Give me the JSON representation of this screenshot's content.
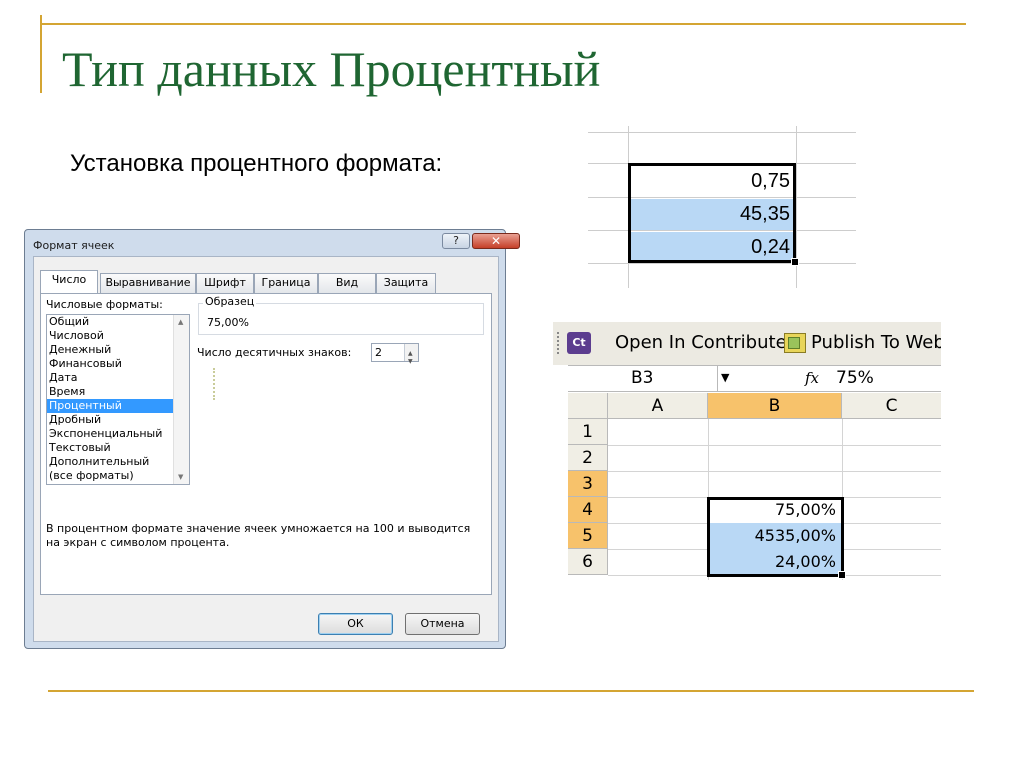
{
  "slide": {
    "title": "Тип данных Процентный",
    "subtitle": "Установка процентного формата:",
    "accent_color": "#d4a533",
    "title_color": "#1f6632"
  },
  "dialog": {
    "title": "Формат ячеек",
    "help": "?",
    "close": "✕",
    "tabs": [
      "Число",
      "Выравнивание",
      "Шрифт",
      "Граница",
      "Вид",
      "Защита"
    ],
    "active_tab": "Число",
    "category_label": "Числовые форматы:",
    "categories": [
      "Общий",
      "Числовой",
      "Денежный",
      "Финансовый",
      "Дата",
      "Время",
      "Процентный",
      "Дробный",
      "Экспоненциальный",
      "Текстовый",
      "Дополнительный",
      "(все форматы)"
    ],
    "selected_category": "Процентный",
    "sample_label": "Образец",
    "sample_value": "75,00%",
    "decimals_label": "Число десятичных знаков:",
    "decimals_value": "2",
    "description": "В процентном формате значение ячеек умножается на 100 и выводится на экран с символом процента.",
    "ok": "ОК",
    "cancel": "Отмена"
  },
  "mini_sheet": {
    "values": [
      "0,75",
      "45,35",
      "0,24"
    ],
    "highlight_color": "#b9d8f5"
  },
  "excel": {
    "toolbar": {
      "contribute_icon": "Ct",
      "contribute_label": "Open In Contribute",
      "publish_label": "Publish To Web"
    },
    "name_box": "B3",
    "fx": "fx",
    "formula_value": "75%",
    "columns": [
      "A",
      "B",
      "C"
    ],
    "rows": [
      "1",
      "2",
      "3",
      "4",
      "5",
      "6"
    ],
    "selected_column": "B",
    "selected_rows": [
      "3",
      "4",
      "5"
    ],
    "b_values": [
      "75,00%",
      "4535,00%",
      "24,00%"
    ],
    "header_highlight_color": "#f7c26b"
  }
}
